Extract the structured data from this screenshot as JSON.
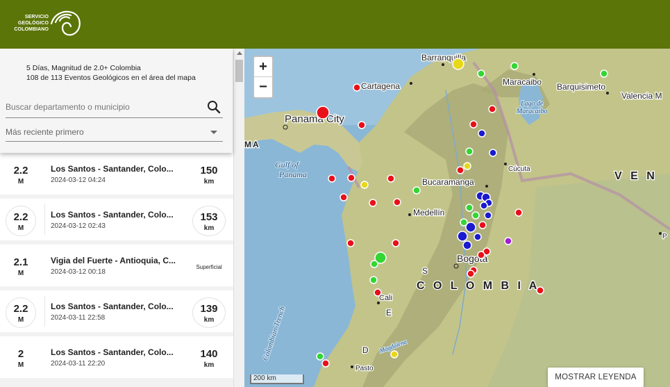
{
  "header": {
    "logo_line1": "SERVICIO",
    "logo_line2": "GEOLÓGICO",
    "logo_line3": "COLOMBIANO",
    "brand_color": "#5b7508"
  },
  "filter": {
    "summary_title": "5 Días, Magnitud de 2.0+ Colombia",
    "summary_count": "108 de 113 Eventos Geológicos en el área del mapa",
    "search_placeholder": "Buscar departamento o municipio",
    "sort_selected": "Más reciente primero"
  },
  "events": [
    {
      "mag": "2.2",
      "mag_unit": "M",
      "title": "Los Santos - Santander, Colo...",
      "date": "2024-03-12 04:24",
      "depth": "150",
      "depth_unit": "km",
      "ring": false
    },
    {
      "mag": "2.2",
      "mag_unit": "M",
      "title": "Los Santos - Santander, Colo...",
      "date": "2024-03-12 02:43",
      "depth": "153",
      "depth_unit": "km",
      "ring": true
    },
    {
      "mag": "2.1",
      "mag_unit": "M",
      "title": "Vigia del Fuerte - Antioquia, C...",
      "date": "2024-03-12 00:18",
      "depth_text": "Superficial",
      "ring": false
    },
    {
      "mag": "2.2",
      "mag_unit": "M",
      "title": "Los Santos - Santander, Colo...",
      "date": "2024-03-11 22:58",
      "depth": "139",
      "depth_unit": "km",
      "ring": true
    },
    {
      "mag": "2",
      "mag_unit": "M",
      "title": "Los Santos - Santander, Colo...",
      "date": "2024-03-11 22:20",
      "depth": "140",
      "depth_unit": "km",
      "ring": false
    }
  ],
  "map": {
    "zoom_in": "+",
    "zoom_out": "−",
    "scale": "200 km",
    "legend_button": "MOSTRAR LEYENDA",
    "labels": {
      "barranquilla": "Barranquilla",
      "cartagena": "Cartagena",
      "maracaibo": "Maracaibo",
      "lago": "Lago de",
      "maracaibo_lake": "Maracaibo",
      "barquisimeto": "Barquisimeto",
      "valencia": "Valencia M",
      "panama_city": "Panama City",
      "gulf1": "Gulf of",
      "gulf2": "Panama",
      "ma": "MA",
      "cucuta": "Cúcuta",
      "bucaramanga": "Bucaramanga",
      "medellin": "Medellín",
      "bogota": "Bogotá",
      "colombia": "C O L O M B I A",
      "ven": "V E N",
      "cali": "Cali",
      "pasto": "Pasto",
      "trench": "Colombian Trench",
      "magdalena": "Magdalena",
      "p_label": "P",
      "andes_s": "S",
      "andes_e": "E",
      "andes_d": "D"
    }
  }
}
